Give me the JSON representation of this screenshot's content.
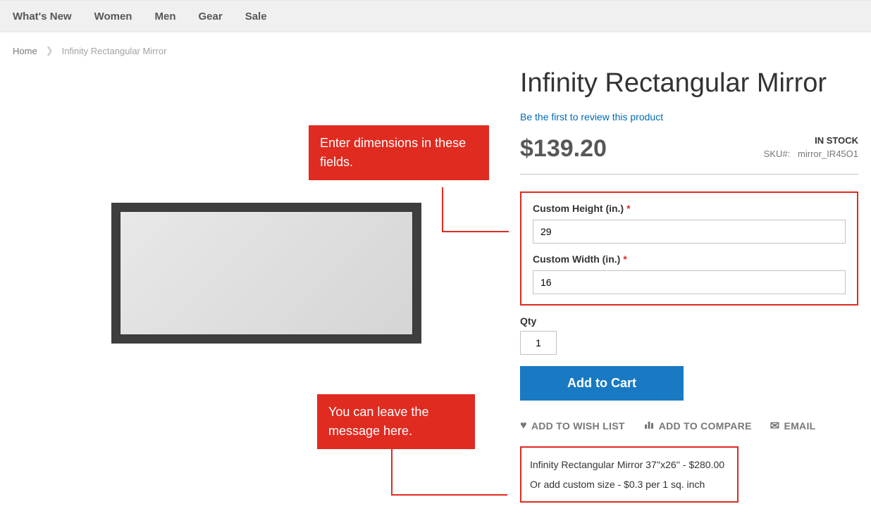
{
  "nav": {
    "items": [
      "What's New",
      "Women",
      "Men",
      "Gear",
      "Sale"
    ]
  },
  "breadcrumb": {
    "home": "Home",
    "current": "Infinity Rectangular Mirror"
  },
  "callouts": {
    "dimensions": "Enter dimensions in these fields.",
    "message": "You can leave the message here."
  },
  "product": {
    "title": "Infinity Rectangular Mirror",
    "review_link": "Be the first to review this product",
    "price": "$139.20",
    "stock_status": "IN STOCK",
    "sku_label": "SKU#:",
    "sku_value": "mirror_IR45O1"
  },
  "fields": {
    "height_label": "Custom Height (in.)",
    "height_value": "29",
    "width_label": "Custom Width (in.)",
    "width_value": "16",
    "qty_label": "Qty",
    "qty_value": "1"
  },
  "buttons": {
    "add_to_cart": "Add to Cart"
  },
  "actions": {
    "wishlist": "ADD TO WISH LIST",
    "compare": "ADD TO COMPARE",
    "email": "EMAIL"
  },
  "message_box": {
    "line1": "Infinity Rectangular Mirror 37''x26'' - $280.00",
    "line2": "Or add custom size - $0.3 per 1 sq. inch"
  }
}
